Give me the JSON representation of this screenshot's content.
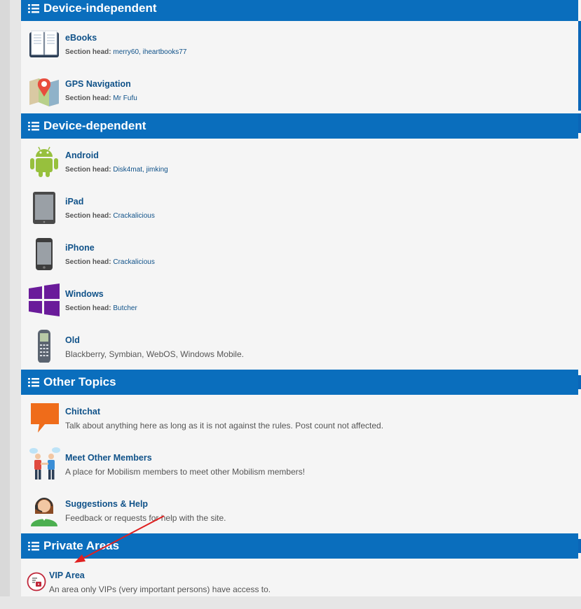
{
  "sections": [
    {
      "title": "Device-independent",
      "forums": [
        {
          "title": "eBooks",
          "meta_label": "Section head:",
          "meta_value": "merry60, iheartbooks77",
          "icon": "book-icon"
        },
        {
          "title": "GPS Navigation",
          "meta_label": "Section head:",
          "meta_value": "Mr Fufu",
          "icon": "map-pin-icon"
        }
      ]
    },
    {
      "title": "Device-dependent",
      "forums": [
        {
          "title": "Android",
          "meta_label": "Section head:",
          "meta_value": "Disk4mat, jimking",
          "icon": "android-icon"
        },
        {
          "title": "iPad",
          "meta_label": "Section head:",
          "meta_value": "Crackalicious",
          "icon": "tablet-icon"
        },
        {
          "title": "iPhone",
          "meta_label": "Section head:",
          "meta_value": "Crackalicious",
          "icon": "phone-icon"
        },
        {
          "title": "Windows",
          "meta_label": "Section head:",
          "meta_value": "Butcher",
          "icon": "windows-logo-icon"
        },
        {
          "title": "Old",
          "description": "Blackberry, Symbian, WebOS, Windows Mobile.",
          "icon": "old-phone-icon"
        }
      ]
    },
    {
      "title": "Other Topics",
      "forums": [
        {
          "title": "Chitchat",
          "description": "Talk about anything here as long as it is not against the rules. Post count not affected.",
          "icon": "speech-bubble-icon"
        },
        {
          "title": "Meet Other Members",
          "description": "A place for Mobilism members to meet other Mobilism members!",
          "icon": "people-meeting-icon"
        },
        {
          "title": "Suggestions & Help",
          "description": "Feedback or requests for help with the site.",
          "icon": "support-agent-icon"
        }
      ]
    },
    {
      "title": "Private Areas",
      "forums": [
        {
          "title": "VIP Area",
          "description": "An area only VIPs (very important persons) have access to.",
          "icon": "vip-badge-icon"
        }
      ]
    }
  ],
  "colors": {
    "header_bg": "#0a6ebd",
    "link": "#105289",
    "annotation_arrow": "#e02020"
  }
}
